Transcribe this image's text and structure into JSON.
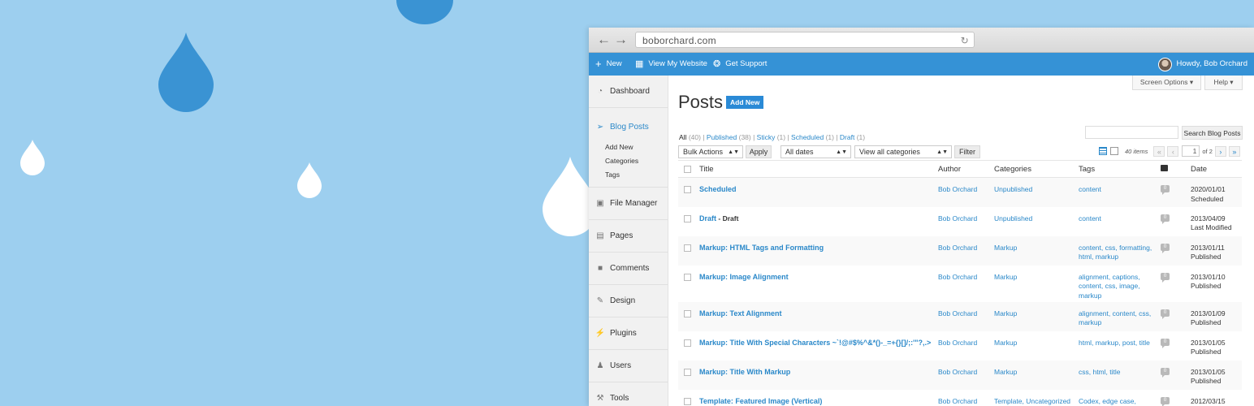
{
  "browser": {
    "url": "boborchard.com"
  },
  "adminbar": {
    "new_label": "New",
    "view_site_label": "View My Website",
    "support_label": "Get Support",
    "howdy_label": "Howdy, Bob Orchard"
  },
  "sidebar": {
    "items": [
      {
        "label": "Dashboard",
        "icon": "dashboard-icon"
      },
      {
        "label": "Blog Posts",
        "icon": "pin-icon"
      },
      {
        "label": "File Manager",
        "icon": "media-icon"
      },
      {
        "label": "Pages",
        "icon": "pages-icon"
      },
      {
        "label": "Comments",
        "icon": "comments-icon"
      },
      {
        "label": "Design",
        "icon": "brush-icon"
      },
      {
        "label": "Plugins",
        "icon": "plugin-icon"
      },
      {
        "label": "Users",
        "icon": "users-icon"
      },
      {
        "label": "Tools",
        "icon": "wrench-icon"
      }
    ],
    "submenu": [
      "Add New",
      "Categories",
      "Tags"
    ]
  },
  "screen_options_label": "Screen Options",
  "help_label": "Help",
  "page_title": "Posts",
  "add_new_label": "Add New",
  "status_links": {
    "all": "All",
    "all_count": "(40)",
    "published": "Published",
    "published_count": "(38)",
    "sticky": "Sticky",
    "sticky_count": "(1)",
    "scheduled": "Scheduled",
    "scheduled_count": "(1)",
    "draft": "Draft",
    "draft_count": "(1)"
  },
  "search_button_label": "Search Blog Posts",
  "bulk_actions_label": "Bulk Actions",
  "apply_label": "Apply",
  "dates_label": "All dates",
  "categories_filter_label": "View all categories",
  "filter_label": "Filter",
  "pagination": {
    "items": "40 items",
    "current": "1",
    "of": "of 2"
  },
  "columns": {
    "title": "Title",
    "author": "Author",
    "categories": "Categories",
    "tags": "Tags",
    "date": "Date"
  },
  "posts": [
    {
      "title": "Scheduled",
      "state": "",
      "author": "Bob Orchard",
      "categories": "Unpublished",
      "tags_lines": [
        "content"
      ],
      "comments": "0",
      "date": "2020/01/01",
      "status": "Scheduled"
    },
    {
      "title": "Draft",
      "state": " - Draft",
      "author": "Bob Orchard",
      "categories": "Unpublished",
      "tags_lines": [
        "content"
      ],
      "comments": "0",
      "date": "2013/04/09",
      "status": "Last Modified"
    },
    {
      "title": "Markup: HTML Tags and Formatting",
      "state": "",
      "author": "Bob Orchard",
      "categories": "Markup",
      "tags_lines": [
        "content, css, formatting,",
        "html, markup"
      ],
      "comments": "0",
      "date": "2013/01/11",
      "status": "Published"
    },
    {
      "title": "Markup: Image Alignment",
      "state": "",
      "author": "Bob Orchard",
      "categories": "Markup",
      "tags_lines": [
        "alignment, captions,",
        "content, css, image,",
        "markup"
      ],
      "comments": "0",
      "date": "2013/01/10",
      "status": "Published"
    },
    {
      "title": "Markup: Text Alignment",
      "state": "",
      "author": "Bob Orchard",
      "categories": "Markup",
      "tags_lines": [
        "alignment, content, css,",
        "markup"
      ],
      "comments": "0",
      "date": "2013/01/09",
      "status": "Published"
    },
    {
      "title": "Markup: Title With Special Characters ~`!@#$%^&*()-_=+{}[]/;:'\"?,.>",
      "state": "",
      "author": "Bob Orchard",
      "categories": "Markup",
      "tags_lines": [
        "html, markup, post, title"
      ],
      "comments": "0",
      "date": "2013/01/05",
      "status": "Published"
    },
    {
      "title": "Markup: Title With Markup",
      "state": "",
      "author": "Bob Orchard",
      "categories": "Markup",
      "tags_lines": [
        "css, html, title"
      ],
      "comments": "0",
      "date": "2013/01/05",
      "status": "Published"
    },
    {
      "title": "Template: Featured Image (Vertical)",
      "state": "",
      "author": "Bob Orchard",
      "categories": "Template, Uncategorized",
      "tags_lines": [
        "Codex, edge case,"
      ],
      "comments": "0",
      "date": "2012/03/15",
      "status": ""
    }
  ],
  "colors": {
    "background": "#9dcfef",
    "drop_dark": "#3a93d3",
    "drop_light": "#ffffff",
    "adminbar": "#3592d6",
    "link": "#2a88c9"
  }
}
